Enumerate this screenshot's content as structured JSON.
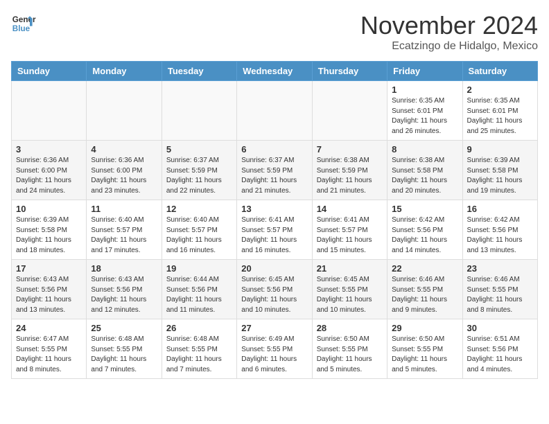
{
  "logo": {
    "line1": "General",
    "line2": "Blue"
  },
  "title": "November 2024",
  "location": "Ecatzingo de Hidalgo, Mexico",
  "weekdays": [
    "Sunday",
    "Monday",
    "Tuesday",
    "Wednesday",
    "Thursday",
    "Friday",
    "Saturday"
  ],
  "weeks": [
    [
      {
        "day": "",
        "info": ""
      },
      {
        "day": "",
        "info": ""
      },
      {
        "day": "",
        "info": ""
      },
      {
        "day": "",
        "info": ""
      },
      {
        "day": "",
        "info": ""
      },
      {
        "day": "1",
        "info": "Sunrise: 6:35 AM\nSunset: 6:01 PM\nDaylight: 11 hours and 26 minutes."
      },
      {
        "day": "2",
        "info": "Sunrise: 6:35 AM\nSunset: 6:01 PM\nDaylight: 11 hours and 25 minutes."
      }
    ],
    [
      {
        "day": "3",
        "info": "Sunrise: 6:36 AM\nSunset: 6:00 PM\nDaylight: 11 hours and 24 minutes."
      },
      {
        "day": "4",
        "info": "Sunrise: 6:36 AM\nSunset: 6:00 PM\nDaylight: 11 hours and 23 minutes."
      },
      {
        "day": "5",
        "info": "Sunrise: 6:37 AM\nSunset: 5:59 PM\nDaylight: 11 hours and 22 minutes."
      },
      {
        "day": "6",
        "info": "Sunrise: 6:37 AM\nSunset: 5:59 PM\nDaylight: 11 hours and 21 minutes."
      },
      {
        "day": "7",
        "info": "Sunrise: 6:38 AM\nSunset: 5:59 PM\nDaylight: 11 hours and 21 minutes."
      },
      {
        "day": "8",
        "info": "Sunrise: 6:38 AM\nSunset: 5:58 PM\nDaylight: 11 hours and 20 minutes."
      },
      {
        "day": "9",
        "info": "Sunrise: 6:39 AM\nSunset: 5:58 PM\nDaylight: 11 hours and 19 minutes."
      }
    ],
    [
      {
        "day": "10",
        "info": "Sunrise: 6:39 AM\nSunset: 5:58 PM\nDaylight: 11 hours and 18 minutes."
      },
      {
        "day": "11",
        "info": "Sunrise: 6:40 AM\nSunset: 5:57 PM\nDaylight: 11 hours and 17 minutes."
      },
      {
        "day": "12",
        "info": "Sunrise: 6:40 AM\nSunset: 5:57 PM\nDaylight: 11 hours and 16 minutes."
      },
      {
        "day": "13",
        "info": "Sunrise: 6:41 AM\nSunset: 5:57 PM\nDaylight: 11 hours and 16 minutes."
      },
      {
        "day": "14",
        "info": "Sunrise: 6:41 AM\nSunset: 5:57 PM\nDaylight: 11 hours and 15 minutes."
      },
      {
        "day": "15",
        "info": "Sunrise: 6:42 AM\nSunset: 5:56 PM\nDaylight: 11 hours and 14 minutes."
      },
      {
        "day": "16",
        "info": "Sunrise: 6:42 AM\nSunset: 5:56 PM\nDaylight: 11 hours and 13 minutes."
      }
    ],
    [
      {
        "day": "17",
        "info": "Sunrise: 6:43 AM\nSunset: 5:56 PM\nDaylight: 11 hours and 13 minutes."
      },
      {
        "day": "18",
        "info": "Sunrise: 6:43 AM\nSunset: 5:56 PM\nDaylight: 11 hours and 12 minutes."
      },
      {
        "day": "19",
        "info": "Sunrise: 6:44 AM\nSunset: 5:56 PM\nDaylight: 11 hours and 11 minutes."
      },
      {
        "day": "20",
        "info": "Sunrise: 6:45 AM\nSunset: 5:56 PM\nDaylight: 11 hours and 10 minutes."
      },
      {
        "day": "21",
        "info": "Sunrise: 6:45 AM\nSunset: 5:55 PM\nDaylight: 11 hours and 10 minutes."
      },
      {
        "day": "22",
        "info": "Sunrise: 6:46 AM\nSunset: 5:55 PM\nDaylight: 11 hours and 9 minutes."
      },
      {
        "day": "23",
        "info": "Sunrise: 6:46 AM\nSunset: 5:55 PM\nDaylight: 11 hours and 8 minutes."
      }
    ],
    [
      {
        "day": "24",
        "info": "Sunrise: 6:47 AM\nSunset: 5:55 PM\nDaylight: 11 hours and 8 minutes."
      },
      {
        "day": "25",
        "info": "Sunrise: 6:48 AM\nSunset: 5:55 PM\nDaylight: 11 hours and 7 minutes."
      },
      {
        "day": "26",
        "info": "Sunrise: 6:48 AM\nSunset: 5:55 PM\nDaylight: 11 hours and 7 minutes."
      },
      {
        "day": "27",
        "info": "Sunrise: 6:49 AM\nSunset: 5:55 PM\nDaylight: 11 hours and 6 minutes."
      },
      {
        "day": "28",
        "info": "Sunrise: 6:50 AM\nSunset: 5:55 PM\nDaylight: 11 hours and 5 minutes."
      },
      {
        "day": "29",
        "info": "Sunrise: 6:50 AM\nSunset: 5:55 PM\nDaylight: 11 hours and 5 minutes."
      },
      {
        "day": "30",
        "info": "Sunrise: 6:51 AM\nSunset: 5:56 PM\nDaylight: 11 hours and 4 minutes."
      }
    ]
  ]
}
